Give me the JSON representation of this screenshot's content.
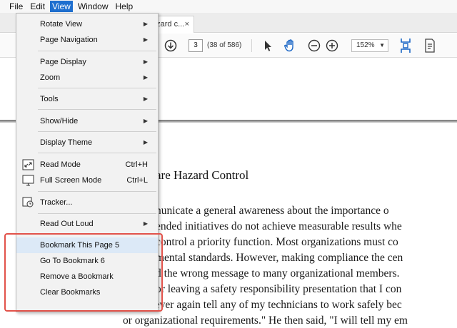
{
  "menubar": {
    "items": [
      "File",
      "Edit",
      "View",
      "Window",
      "Help"
    ],
    "active": "View",
    "active_color": "#1e6fcf"
  },
  "tab": {
    "label": "azard c...",
    "close": "×"
  },
  "toolbar": {
    "page_number": "3",
    "page_count": "(38 of 586)",
    "zoom": "152%",
    "icons": [
      "down-arrow-circle-icon",
      "pointer-icon",
      "hand-icon",
      "zoom-out-icon",
      "zoom-in-icon",
      "fit-page-icon",
      "scan-icon"
    ]
  },
  "document": {
    "heading": "are Hazard Control",
    "lines": [
      "nunicate a general awareness about the importance o",
      "ended initiatives do not achieve measurable results whe",
      "control a priority function. Most organizations must co",
      "mental standards. However, making compliance the cen",
      "d the wrong message to many organizational members.",
      "or leaving a safety responsibility presentation that I con",
      "I will never again tell any of my technicians to work safely bec",
      "or organizational requirements.\" He then said, \"I will tell my em"
    ]
  },
  "view_menu": {
    "items": [
      {
        "label": "Rotate View",
        "submenu": true
      },
      {
        "label": "Page Navigation",
        "submenu": true
      },
      {
        "label": "Page Display",
        "submenu": true
      },
      {
        "label": "Zoom",
        "submenu": true
      },
      {
        "label": "Tools",
        "submenu": true
      },
      {
        "label": "Show/Hide",
        "submenu": true
      },
      {
        "label": "Display Theme",
        "submenu": true
      },
      {
        "label": "Read Mode",
        "shortcut": "Ctrl+H",
        "icon": "read-mode-icon"
      },
      {
        "label": "Full Screen Mode",
        "shortcut": "Ctrl+L",
        "icon": "full-screen-icon"
      },
      {
        "label": "Tracker...",
        "icon": "tracker-icon"
      },
      {
        "label": "Read Out Loud",
        "submenu": true
      },
      {
        "label": "Bookmark This Page 5"
      },
      {
        "label": "Go To Bookmark 6"
      },
      {
        "label": "Remove a Bookmark"
      },
      {
        "label": "Clear Bookmarks"
      }
    ],
    "highlight_color": "#e2524a"
  }
}
